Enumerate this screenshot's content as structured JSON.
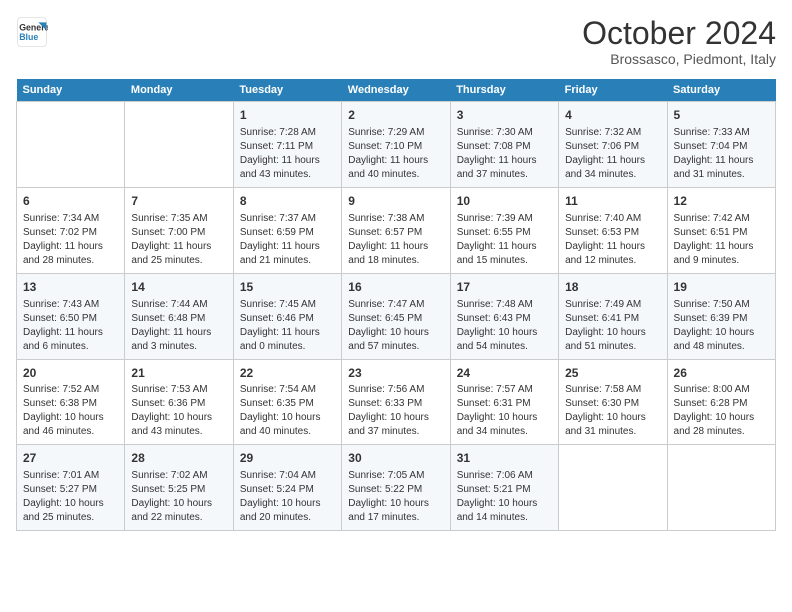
{
  "header": {
    "logo_line1": "General",
    "logo_line2": "Blue",
    "month_title": "October 2024",
    "location": "Brossasco, Piedmont, Italy"
  },
  "weekdays": [
    "Sunday",
    "Monday",
    "Tuesday",
    "Wednesday",
    "Thursday",
    "Friday",
    "Saturday"
  ],
  "weeks": [
    [
      {
        "day": "",
        "info": ""
      },
      {
        "day": "",
        "info": ""
      },
      {
        "day": "1",
        "info": "Sunrise: 7:28 AM\nSunset: 7:11 PM\nDaylight: 11 hours and 43 minutes."
      },
      {
        "day": "2",
        "info": "Sunrise: 7:29 AM\nSunset: 7:10 PM\nDaylight: 11 hours and 40 minutes."
      },
      {
        "day": "3",
        "info": "Sunrise: 7:30 AM\nSunset: 7:08 PM\nDaylight: 11 hours and 37 minutes."
      },
      {
        "day": "4",
        "info": "Sunrise: 7:32 AM\nSunset: 7:06 PM\nDaylight: 11 hours and 34 minutes."
      },
      {
        "day": "5",
        "info": "Sunrise: 7:33 AM\nSunset: 7:04 PM\nDaylight: 11 hours and 31 minutes."
      }
    ],
    [
      {
        "day": "6",
        "info": "Sunrise: 7:34 AM\nSunset: 7:02 PM\nDaylight: 11 hours and 28 minutes."
      },
      {
        "day": "7",
        "info": "Sunrise: 7:35 AM\nSunset: 7:00 PM\nDaylight: 11 hours and 25 minutes."
      },
      {
        "day": "8",
        "info": "Sunrise: 7:37 AM\nSunset: 6:59 PM\nDaylight: 11 hours and 21 minutes."
      },
      {
        "day": "9",
        "info": "Sunrise: 7:38 AM\nSunset: 6:57 PM\nDaylight: 11 hours and 18 minutes."
      },
      {
        "day": "10",
        "info": "Sunrise: 7:39 AM\nSunset: 6:55 PM\nDaylight: 11 hours and 15 minutes."
      },
      {
        "day": "11",
        "info": "Sunrise: 7:40 AM\nSunset: 6:53 PM\nDaylight: 11 hours and 12 minutes."
      },
      {
        "day": "12",
        "info": "Sunrise: 7:42 AM\nSunset: 6:51 PM\nDaylight: 11 hours and 9 minutes."
      }
    ],
    [
      {
        "day": "13",
        "info": "Sunrise: 7:43 AM\nSunset: 6:50 PM\nDaylight: 11 hours and 6 minutes."
      },
      {
        "day": "14",
        "info": "Sunrise: 7:44 AM\nSunset: 6:48 PM\nDaylight: 11 hours and 3 minutes."
      },
      {
        "day": "15",
        "info": "Sunrise: 7:45 AM\nSunset: 6:46 PM\nDaylight: 11 hours and 0 minutes."
      },
      {
        "day": "16",
        "info": "Sunrise: 7:47 AM\nSunset: 6:45 PM\nDaylight: 10 hours and 57 minutes."
      },
      {
        "day": "17",
        "info": "Sunrise: 7:48 AM\nSunset: 6:43 PM\nDaylight: 10 hours and 54 minutes."
      },
      {
        "day": "18",
        "info": "Sunrise: 7:49 AM\nSunset: 6:41 PM\nDaylight: 10 hours and 51 minutes."
      },
      {
        "day": "19",
        "info": "Sunrise: 7:50 AM\nSunset: 6:39 PM\nDaylight: 10 hours and 48 minutes."
      }
    ],
    [
      {
        "day": "20",
        "info": "Sunrise: 7:52 AM\nSunset: 6:38 PM\nDaylight: 10 hours and 46 minutes."
      },
      {
        "day": "21",
        "info": "Sunrise: 7:53 AM\nSunset: 6:36 PM\nDaylight: 10 hours and 43 minutes."
      },
      {
        "day": "22",
        "info": "Sunrise: 7:54 AM\nSunset: 6:35 PM\nDaylight: 10 hours and 40 minutes."
      },
      {
        "day": "23",
        "info": "Sunrise: 7:56 AM\nSunset: 6:33 PM\nDaylight: 10 hours and 37 minutes."
      },
      {
        "day": "24",
        "info": "Sunrise: 7:57 AM\nSunset: 6:31 PM\nDaylight: 10 hours and 34 minutes."
      },
      {
        "day": "25",
        "info": "Sunrise: 7:58 AM\nSunset: 6:30 PM\nDaylight: 10 hours and 31 minutes."
      },
      {
        "day": "26",
        "info": "Sunrise: 8:00 AM\nSunset: 6:28 PM\nDaylight: 10 hours and 28 minutes."
      }
    ],
    [
      {
        "day": "27",
        "info": "Sunrise: 7:01 AM\nSunset: 5:27 PM\nDaylight: 10 hours and 25 minutes."
      },
      {
        "day": "28",
        "info": "Sunrise: 7:02 AM\nSunset: 5:25 PM\nDaylight: 10 hours and 22 minutes."
      },
      {
        "day": "29",
        "info": "Sunrise: 7:04 AM\nSunset: 5:24 PM\nDaylight: 10 hours and 20 minutes."
      },
      {
        "day": "30",
        "info": "Sunrise: 7:05 AM\nSunset: 5:22 PM\nDaylight: 10 hours and 17 minutes."
      },
      {
        "day": "31",
        "info": "Sunrise: 7:06 AM\nSunset: 5:21 PM\nDaylight: 10 hours and 14 minutes."
      },
      {
        "day": "",
        "info": ""
      },
      {
        "day": "",
        "info": ""
      }
    ]
  ]
}
